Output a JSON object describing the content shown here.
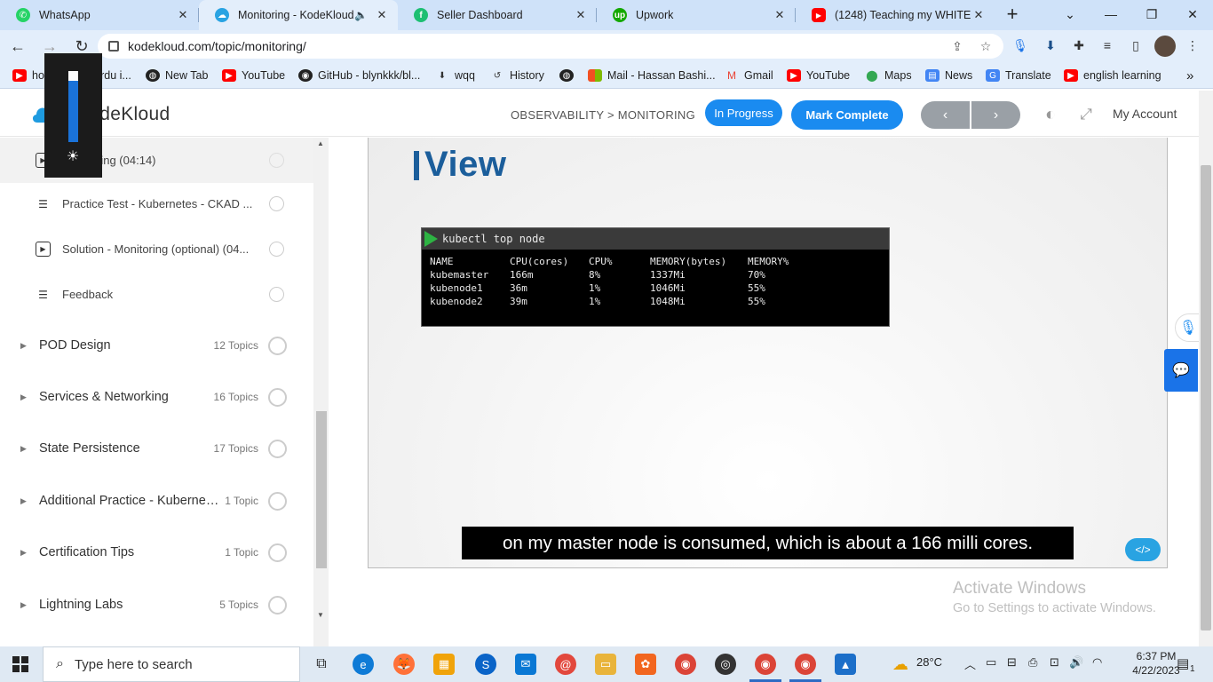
{
  "browser": {
    "tabs": [
      {
        "title": "WhatsApp",
        "icon": "whatsapp-icon",
        "color": "#25d366"
      },
      {
        "title": "Monitoring - KodeKloud",
        "icon": "kodekloud-icon",
        "color": "#29a3e2",
        "active": true
      },
      {
        "title": "Seller Dashboard",
        "icon": "fiverr-icon",
        "color": "#1dbf73"
      },
      {
        "title": "Upwork",
        "icon": "upwork-icon",
        "color": "#14a800"
      },
      {
        "title": "(1248) Teaching my WHITE fr",
        "icon": "youtube-icon",
        "color": "#ff0000"
      }
    ],
    "url": "kodekloud.com/topic/monitoring/",
    "bookmarks": [
      {
        "label": "how to write urdu i...",
        "icon": "youtube-icon",
        "color": "#ff0000"
      },
      {
        "label": "New Tab",
        "icon": "globe-icon",
        "color": "#222222"
      },
      {
        "label": "YouTube",
        "icon": "youtube-icon",
        "color": "#ff0000"
      },
      {
        "label": "GitHub - blynkkk/bl...",
        "icon": "github-icon",
        "color": "#222222"
      },
      {
        "label": "wqq",
        "icon": "download-icon",
        "color": "#333333"
      },
      {
        "label": "History",
        "icon": "history-icon",
        "color": "#333333"
      },
      {
        "label": "",
        "icon": "globe-icon",
        "color": "#222222"
      },
      {
        "label": "Mail - Hassan Bashi...",
        "icon": "microsoft-icon",
        "color": "#f25022"
      },
      {
        "label": "Gmail",
        "icon": "gmail-icon",
        "color": "#ea4335"
      },
      {
        "label": "YouTube",
        "icon": "youtube-icon",
        "color": "#ff0000"
      },
      {
        "label": "Maps",
        "icon": "maps-icon",
        "color": "#34a853"
      },
      {
        "label": "News",
        "icon": "news-icon",
        "color": "#4285f4"
      },
      {
        "label": "Translate",
        "icon": "translate-icon",
        "color": "#4285f4"
      },
      {
        "label": "english learning",
        "icon": "youtube-icon",
        "color": "#ff0000"
      }
    ]
  },
  "site": {
    "logo_text": "KodeKloud",
    "breadcrumb": "OBSERVABILITY > MONITORING",
    "status_button": "In Progress",
    "complete_button": "Mark Complete",
    "prev_glyph": "‹",
    "next_glyph": "›",
    "account": "My Account",
    "accent_color": "#1a8bf0"
  },
  "sidebar": {
    "lessons": [
      {
        "label": "Monitoring (04:14)",
        "icon": "video-play-icon",
        "current": true
      },
      {
        "label": "Practice Test - Kubernetes - CKAD ...",
        "icon": "quiz-list-icon"
      },
      {
        "label": "Solution - Monitoring (optional) (04...",
        "icon": "video-play-icon"
      },
      {
        "label": "Feedback",
        "icon": "quiz-list-icon"
      }
    ],
    "sections": [
      {
        "label": "POD Design",
        "count": "12 Topics"
      },
      {
        "label": "Services & Networking",
        "count": "16 Topics"
      },
      {
        "label": "State Persistence",
        "count": "17 Topics"
      },
      {
        "label": "Additional Practice - Kubernetes for the Absolute Beginners",
        "count": "1 Topic"
      },
      {
        "label": "Certification Tips",
        "count": "1 Topic"
      },
      {
        "label": "Lightning Labs",
        "count": "5 Topics"
      }
    ]
  },
  "video": {
    "slide_title": "View",
    "terminal_command": "kubectl top node",
    "table_headers": [
      "NAME",
      "CPU(cores)",
      "CPU%",
      "MEMORY(bytes)",
      "MEMORY%"
    ],
    "table_rows": [
      [
        "kubemaster",
        "166m",
        "8%",
        "1337Mi",
        "70%"
      ],
      [
        "kubenode1",
        "36m",
        "1%",
        "1046Mi",
        "55%"
      ],
      [
        "kubenode2",
        "39m",
        "1%",
        "1048Mi",
        "55%"
      ]
    ],
    "caption": "on my master node is consumed, which is about a 166 milli cores."
  },
  "watermark": {
    "line1": "Activate Windows",
    "line2": "Go to Settings to activate Windows."
  },
  "taskbar": {
    "search_placeholder": "Type here to search",
    "weather": "28°C",
    "time": "6:37 PM",
    "date": "4/22/2023",
    "notification_count": "1"
  }
}
